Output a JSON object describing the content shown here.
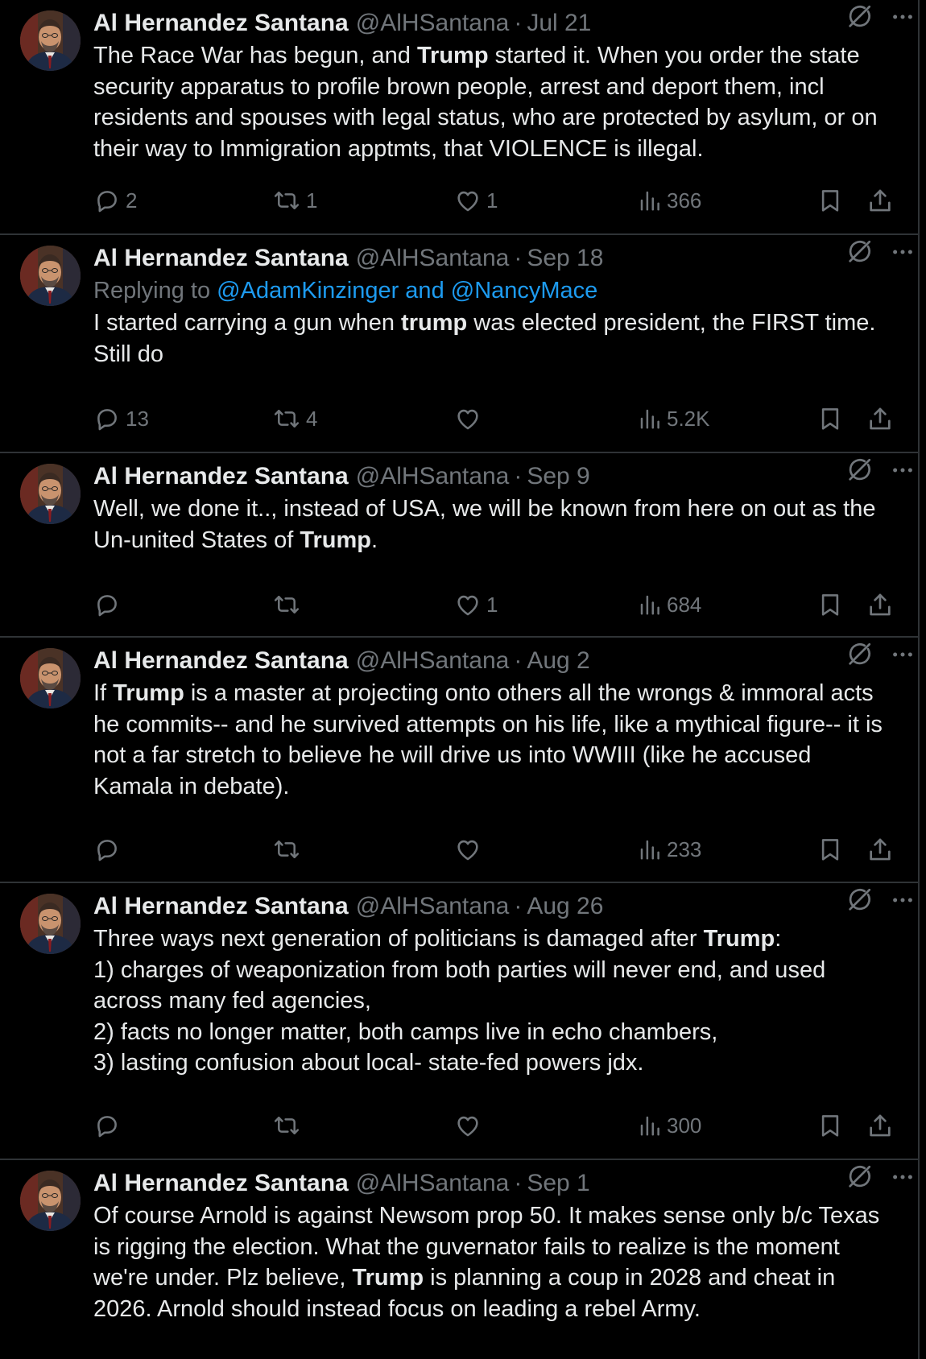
{
  "author": {
    "name": "Al Hernandez Santana",
    "handle": "@AlHSantana"
  },
  "icons": {
    "reply": "reply-icon",
    "repost": "repost-icon",
    "like": "heart-icon",
    "views": "views-icon",
    "bookmark": "bookmark-icon",
    "share": "share-icon",
    "grok": "grok-icon",
    "more": "more-icon"
  },
  "colors": {
    "background": "#000000",
    "text": "#e7e9ea",
    "muted": "#71767b",
    "link": "#1d9bf0",
    "divider": "#2f3336"
  },
  "tweets": [
    {
      "date": "Jul 21",
      "replying_prefix": "",
      "replying_mentions": "",
      "text": "The Race War has begun, and **Trump** started it. When you order the state security apparatus to profile brown people, arrest and deport them, incl residents and spouses with legal status, who are protected by asylum, or on their way to Immigration apptmts, that VIOLENCE is illegal.",
      "replies": "2",
      "reposts": "1",
      "likes": "1",
      "views": "366"
    },
    {
      "date": "Sep 18",
      "replying_prefix": "Replying to ",
      "replying_mentions": "@AdamKinzinger and @NancyMace",
      "text": "I started carrying a gun when **trump** was elected president, the FIRST time. Still do",
      "replies": "13",
      "reposts": "4",
      "likes": "",
      "views": "5.2K"
    },
    {
      "date": "Sep 9",
      "replying_prefix": "",
      "replying_mentions": "",
      "text": "Well, we done it.., instead of USA, we will be known from here on out as the Un-united States of **Trump**.",
      "replies": "",
      "reposts": "",
      "likes": "1",
      "views": "684"
    },
    {
      "date": "Aug 2",
      "replying_prefix": "",
      "replying_mentions": "",
      "text": "If **Trump** is a master at projecting onto others all the wrongs & immoral acts he commits-- and he survived attempts on his life, like a mythical figure-- it is not a far stretch to believe he will drive us into WWIII (like he accused Kamala in debate).",
      "replies": "",
      "reposts": "",
      "likes": "",
      "views": "233"
    },
    {
      "date": "Aug 26",
      "replying_prefix": "",
      "replying_mentions": "",
      "text": "Three ways next generation of politicians is damaged after **Trump**:\n1) charges of weaponization from both parties will never end, and used across many fed agencies,\n2) facts no longer matter, both camps live in echo chambers,\n3) lasting confusion about local- state-fed powers jdx.",
      "replies": "",
      "reposts": "",
      "likes": "",
      "views": "300"
    },
    {
      "date": "Sep 1",
      "replying_prefix": "",
      "replying_mentions": "",
      "text": "Of course Arnold is against Newsom prop 50. It makes sense only b/c Texas is rigging the election. What the guvernator fails to realize is the moment we're under. Plz believe, **Trump** is planning a coup in 2028 and cheat in 2026. Arnold should instead focus on leading a rebel Army.",
      "replies": "",
      "reposts": "",
      "likes": "",
      "views": ""
    }
  ]
}
